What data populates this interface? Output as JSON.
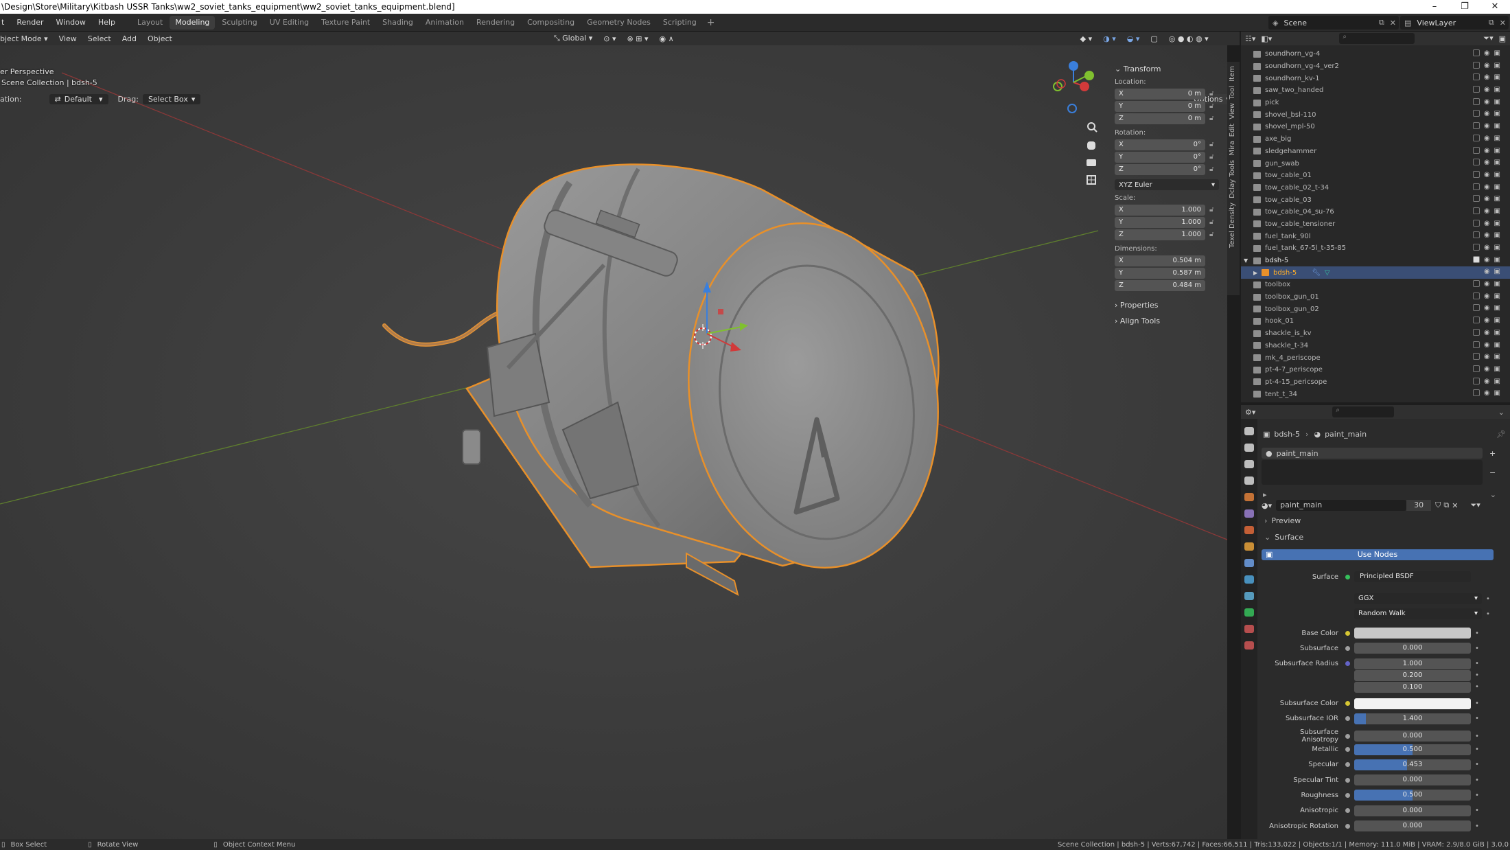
{
  "titlebar": {
    "path": "\\Design\\Store\\Military\\Kitbash USSR Tanks\\ww2_soviet_tanks_equipment\\ww2_soviet_tanks_equipment.blend]",
    "minimize": "–",
    "maximize": "❐",
    "close": "✕"
  },
  "menu": {
    "render": "Render",
    "window": "Window",
    "help": "Help",
    "file_partial": "t"
  },
  "workspaces": [
    "Layout",
    "Modeling",
    "Sculpting",
    "UV Editing",
    "Texture Paint",
    "Shading",
    "Animation",
    "Rendering",
    "Compositing",
    "Geometry Nodes",
    "Scripting"
  ],
  "active_workspace": "Modeling",
  "scene": {
    "label": "Scene",
    "viewlayer": "ViewLayer"
  },
  "header": {
    "mode": "bject Mode",
    "view": "View",
    "select": "Select",
    "add": "Add",
    "object": "Object",
    "orientation": "Global"
  },
  "toolsettings": {
    "orientation_label": "ation:",
    "orientation_value": "Default",
    "drag_label": "Drag:",
    "drag_value": "Select Box",
    "options": "Options"
  },
  "viewport": {
    "perspective": "er Perspective",
    "collection": "Scene Collection | bdsh-5"
  },
  "npanel": {
    "transform": "Transform",
    "location_label": "Location:",
    "location": [
      {
        "axis": "X",
        "value": "0 m"
      },
      {
        "axis": "Y",
        "value": "0 m"
      },
      {
        "axis": "Z",
        "value": "0 m"
      }
    ],
    "rotation_label": "Rotation:",
    "rotation": [
      {
        "axis": "X",
        "value": "0°"
      },
      {
        "axis": "Y",
        "value": "0°"
      },
      {
        "axis": "Z",
        "value": "0°"
      }
    ],
    "rotation_mode": "XYZ Euler",
    "scale_label": "Scale:",
    "scale": [
      {
        "axis": "X",
        "value": "1.000"
      },
      {
        "axis": "Y",
        "value": "1.000"
      },
      {
        "axis": "Z",
        "value": "1.000"
      }
    ],
    "dimensions_label": "Dimensions:",
    "dimensions": [
      {
        "axis": "X",
        "value": "0.504 m"
      },
      {
        "axis": "Y",
        "value": "0.587 m"
      },
      {
        "axis": "Z",
        "value": "0.484 m"
      }
    ],
    "properties": "Properties",
    "align_tools": "Align Tools",
    "tabs": [
      "Item",
      "Tool",
      "View",
      "Edit",
      "Mira",
      "Dclay Tools",
      "Texel Density"
    ]
  },
  "outliner": {
    "items": [
      {
        "name": "soundhorn_vg-4"
      },
      {
        "name": "soundhorn_vg-4_ver2"
      },
      {
        "name": "soundhorn_kv-1"
      },
      {
        "name": "saw_two_handed"
      },
      {
        "name": "pick"
      },
      {
        "name": "shovel_bsl-110"
      },
      {
        "name": "shovel_mpl-50"
      },
      {
        "name": "axe_big"
      },
      {
        "name": "sledgehammer"
      },
      {
        "name": "gun_swab"
      },
      {
        "name": "tow_cable_01"
      },
      {
        "name": "tow_cable_02_t-34"
      },
      {
        "name": "tow_cable_03"
      },
      {
        "name": "tow_cable_04_su-76"
      },
      {
        "name": "tow_cable_tensioner"
      },
      {
        "name": "fuel_tank_90l"
      },
      {
        "name": "fuel_tank_67-5l_t-35-85"
      },
      {
        "name": "bdsh-5"
      },
      {
        "name": "bdsh-5"
      },
      {
        "name": "toolbox"
      },
      {
        "name": "toolbox_gun_01"
      },
      {
        "name": "toolbox_gun_02"
      },
      {
        "name": "hook_01"
      },
      {
        "name": "shackle_is_kv"
      },
      {
        "name": "shackle_t-34"
      },
      {
        "name": "mk_4_periscope"
      },
      {
        "name": "pt-4-7_periscope"
      },
      {
        "name": "pt-4-15_pericsope"
      },
      {
        "name": "tent_t_34"
      }
    ]
  },
  "properties": {
    "breadcrumb_object": "bdsh-5",
    "breadcrumb_material": "paint_main",
    "slot": "paint_main",
    "material_name": "paint_main",
    "users": "30",
    "preview": "Preview",
    "surface_section": "Surface",
    "use_nodes": "Use Nodes",
    "surface_label": "Surface",
    "surface_shader": "Principled BSDF",
    "distribution": "GGX",
    "subsurface_method": "Random Walk",
    "fields": [
      {
        "label": "Base Color",
        "value": "",
        "kind": "color",
        "color": "#c8c8c8",
        "dot": "#d6c633"
      },
      {
        "label": "Subsurface",
        "value": "0.000",
        "kind": "num",
        "fill": 0,
        "dot": "#a0a0a0"
      },
      {
        "label": "Subsurface Radius",
        "value": "1.000",
        "kind": "vec",
        "dot": "#6363c7"
      },
      {
        "label": "",
        "value": "0.200",
        "kind": "vec2"
      },
      {
        "label": "",
        "value": "0.100",
        "kind": "vec2"
      },
      {
        "label": "Subsurface Color",
        "value": "",
        "kind": "color",
        "color": "#f2f2f2",
        "dot": "#d6c633"
      },
      {
        "label": "Subsurface IOR",
        "value": "1.400",
        "kind": "num",
        "fill": 0.1,
        "dot": "#a0a0a0"
      },
      {
        "label": "Subsurface Anisotropy",
        "value": "0.000",
        "kind": "num",
        "fill": 0,
        "dot": "#a0a0a0"
      },
      {
        "label": "Metallic",
        "value": "0.500",
        "kind": "num",
        "fill": 0.5,
        "dot": "#a0a0a0"
      },
      {
        "label": "Specular",
        "value": "0.453",
        "kind": "num",
        "fill": 0.453,
        "dot": "#a0a0a0"
      },
      {
        "label": "Specular Tint",
        "value": "0.000",
        "kind": "num",
        "fill": 0,
        "dot": "#a0a0a0"
      },
      {
        "label": "Roughness",
        "value": "0.500",
        "kind": "num",
        "fill": 0.5,
        "dot": "#a0a0a0"
      },
      {
        "label": "Anisotropic",
        "value": "0.000",
        "kind": "num",
        "fill": 0,
        "dot": "#a0a0a0"
      },
      {
        "label": "Anisotropic Rotation",
        "value": "0.000",
        "kind": "num",
        "fill": 0,
        "dot": "#a0a0a0"
      }
    ]
  },
  "status": {
    "box_select": "Box Select",
    "rotate_view": "Rotate View",
    "context_menu": "Object Context Menu",
    "stats": "Scene Collection | bdsh-5 | Verts:67,742 | Faces:66,511 | Tris:133,022 | Objects:1/1 | Memory: 111.0 MiB | VRAM: 2.9/8.0 GiB | 3.0.0"
  },
  "colors": {
    "selection_outline": "#e8902a",
    "accent_blue": "#4772b3",
    "active_name": "#ffaf29"
  }
}
